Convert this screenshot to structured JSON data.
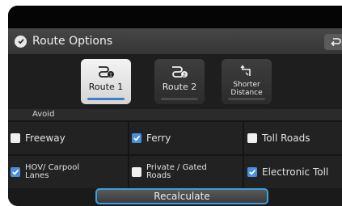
{
  "header": {
    "title": "Route Options"
  },
  "routes": [
    {
      "label": "Route 1",
      "icon": "route-1-icon",
      "selected": true
    },
    {
      "label": "Route 2",
      "icon": "route-2-icon",
      "selected": false
    },
    {
      "label": "Shorter Distance",
      "icon": "shorter-distance-icon",
      "selected": false
    }
  ],
  "avoid": {
    "label": "Avoid",
    "options": [
      {
        "label": "Freeway",
        "checked": false
      },
      {
        "label": "Ferry",
        "checked": true
      },
      {
        "label": "Toll Roads",
        "checked": false
      },
      {
        "label": "HOV/ Carpool Lanes",
        "checked": true
      },
      {
        "label": "Private / Gated Roads",
        "checked": false
      },
      {
        "label": "Electronic Toll",
        "checked": true
      }
    ]
  },
  "actions": {
    "recalculate": "Recalculate"
  },
  "colors": {
    "accent": "#4a8fdf",
    "selection_outline": "#3b9fe0",
    "background": "#151515"
  }
}
